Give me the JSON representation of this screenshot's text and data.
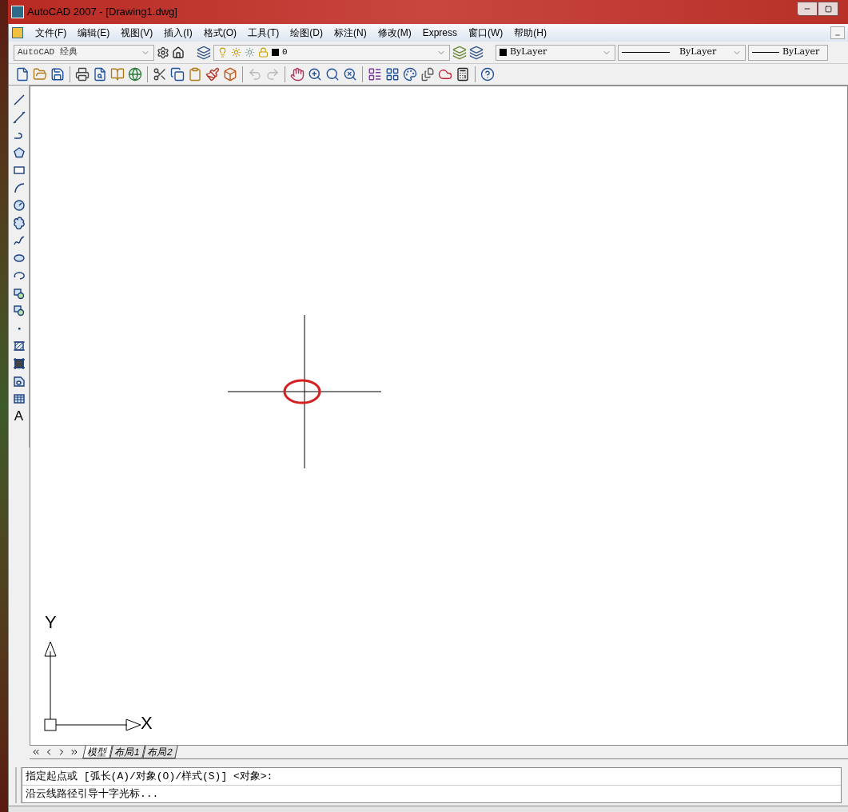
{
  "window": {
    "title": "AutoCAD 2007 - [Drawing1.dwg]"
  },
  "menu": [
    "文件(F)",
    "编辑(E)",
    "视图(V)",
    "插入(I)",
    "格式(O)",
    "工具(T)",
    "绘图(D)",
    "标注(N)",
    "修改(M)",
    "Express",
    "窗口(W)",
    "帮助(H)"
  ],
  "properties_toolbar": {
    "workspace": "AutoCAD 经典",
    "layer": "0",
    "color_control": "ByLayer",
    "linetype": "ByLayer",
    "lineweight": "ByLayer"
  },
  "standard_toolbar": [
    {
      "kind": "new",
      "disabled": false
    },
    {
      "kind": "open",
      "disabled": false
    },
    {
      "kind": "save",
      "disabled": false
    },
    {
      "kind": "sep"
    },
    {
      "kind": "print",
      "disabled": false
    },
    {
      "kind": "preview",
      "disabled": false
    },
    {
      "kind": "publish",
      "disabled": false
    },
    {
      "kind": "web",
      "disabled": false
    },
    {
      "kind": "sep"
    },
    {
      "kind": "cut",
      "disabled": false
    },
    {
      "kind": "copy",
      "disabled": false
    },
    {
      "kind": "paste",
      "disabled": false
    },
    {
      "kind": "match",
      "disabled": false
    },
    {
      "kind": "block",
      "disabled": false
    },
    {
      "kind": "sep"
    },
    {
      "kind": "undo",
      "disabled": true
    },
    {
      "kind": "redo",
      "disabled": true
    },
    {
      "kind": "sep"
    },
    {
      "kind": "pan",
      "disabled": false
    },
    {
      "kind": "zoomrt",
      "disabled": false
    },
    {
      "kind": "zoomwin",
      "disabled": false
    },
    {
      "kind": "zoomprev",
      "disabled": false
    },
    {
      "kind": "sep"
    },
    {
      "kind": "properties",
      "disabled": false
    },
    {
      "kind": "design",
      "disabled": false
    },
    {
      "kind": "palette",
      "disabled": false
    },
    {
      "kind": "sheet",
      "disabled": false
    },
    {
      "kind": "markup",
      "disabled": false
    },
    {
      "kind": "calc",
      "disabled": false
    },
    {
      "kind": "sep"
    },
    {
      "kind": "help",
      "disabled": false
    }
  ],
  "draw_toolbar": [
    {
      "kind": "line"
    },
    {
      "kind": "xline"
    },
    {
      "kind": "pline"
    },
    {
      "kind": "polygon"
    },
    {
      "kind": "rect"
    },
    {
      "kind": "arc"
    },
    {
      "kind": "circle"
    },
    {
      "kind": "cloud"
    },
    {
      "kind": "spline"
    },
    {
      "kind": "ellipse"
    },
    {
      "kind": "ellipsearc"
    },
    {
      "kind": "insert"
    },
    {
      "kind": "makeblock"
    },
    {
      "kind": "point"
    },
    {
      "kind": "hatch"
    },
    {
      "kind": "gradient"
    },
    {
      "kind": "region"
    },
    {
      "kind": "table"
    },
    {
      "kind": "text",
      "glyph": "A"
    }
  ],
  "canvas": {
    "ucs_y": "Y",
    "ucs_x": "X"
  },
  "layout_tabs": [
    {
      "label": "模型",
      "selected": true
    },
    {
      "label": "布局1",
      "selected": false
    },
    {
      "label": "布局2",
      "selected": false
    }
  ],
  "command_lines": [
    "指定起点或 [弧长(A)/对象(O)/样式(S)] <对象>:",
    "沿云线路径引导十字光标..."
  ]
}
